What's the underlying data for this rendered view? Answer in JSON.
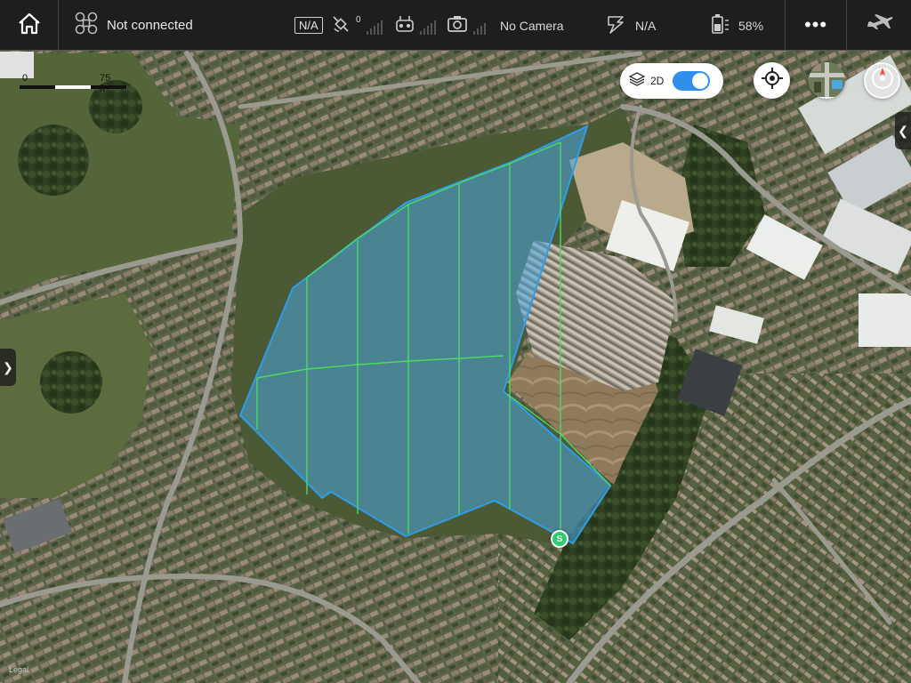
{
  "topbar": {
    "connection_label": "Not connected",
    "gps_status": "N/A",
    "satellite_count": "0",
    "camera_label": "No Camera",
    "mode_label": "N/A",
    "battery_label": "58%",
    "more_label": "•••"
  },
  "map_controls": {
    "view_toggle_label": "2D",
    "view_toggle_on": true,
    "scale_zero": "0",
    "scale_max": "75 ft",
    "legal_label": "Legal",
    "left_tab_glyph": "❯",
    "right_tab_glyph": "❮"
  },
  "flight_plan": {
    "start_marker_label": "S",
    "boundary_color": "#2f9ce8",
    "fill_color": "#4aa8e0",
    "line_color": "#4cd964"
  },
  "icons": [
    "home-icon",
    "drone-icon",
    "gps-icon",
    "satellite-icon",
    "remote-controller-icon",
    "camera-icon",
    "mode-icon",
    "battery-icon",
    "more-icon",
    "aircraft-icon",
    "layers-icon",
    "locate-icon",
    "compass-icon"
  ]
}
